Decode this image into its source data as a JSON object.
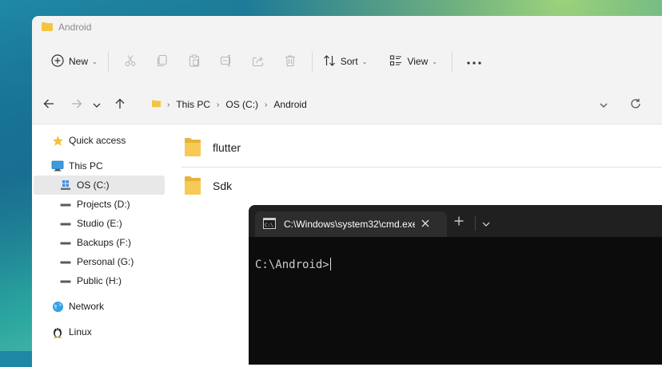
{
  "explorer": {
    "title": "Android",
    "toolbar": {
      "new_label": "New",
      "sort_label": "Sort",
      "view_label": "View"
    },
    "breadcrumb": [
      "This PC",
      "OS (C:)",
      "Android"
    ],
    "sidebar": {
      "quick_access": "Quick access",
      "this_pc": "This PC",
      "drives": [
        "OS (C:)",
        "Projects (D:)",
        "Studio (E:)",
        "Backups (F:)",
        "Personal (G:)",
        "Public (H:)"
      ],
      "network": "Network",
      "linux": "Linux"
    },
    "files": [
      "flutter",
      "Sdk"
    ]
  },
  "terminal": {
    "tab_title": "C:\\Windows\\system32\\cmd.exe",
    "prompt": "C:\\Android>"
  },
  "colors": {
    "folder": "#f4c542",
    "terminal_bg": "#0c0c0c",
    "selected_bg": "#e8e8e8"
  }
}
